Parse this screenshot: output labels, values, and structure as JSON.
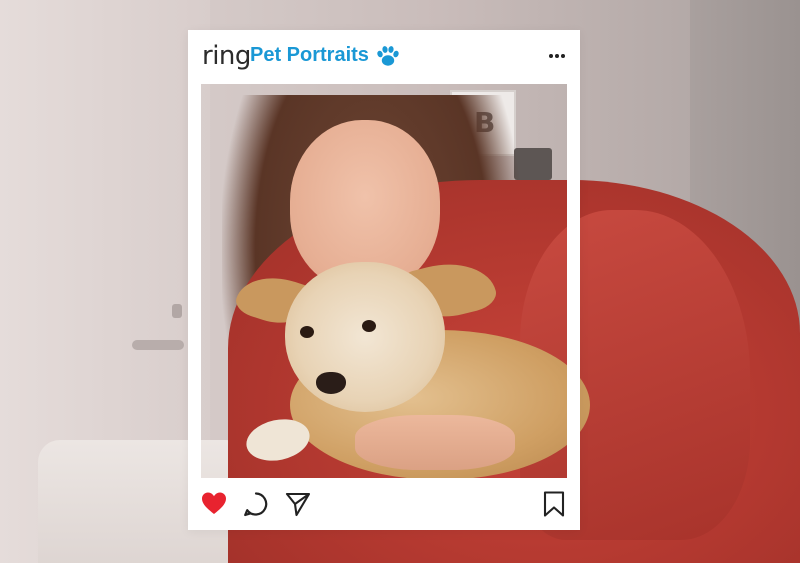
{
  "post": {
    "brand": "ring",
    "title": "Pet Portraits",
    "title_icon": "paw-icon",
    "menu_icon": "more-dots-icon",
    "actions": {
      "like": {
        "icon": "heart-icon",
        "state": "liked",
        "color": "#e8232f"
      },
      "comment": {
        "icon": "comment-icon"
      },
      "share": {
        "icon": "send-icon"
      },
      "save": {
        "icon": "bookmark-icon"
      }
    }
  },
  "colors": {
    "brand_blue": "#1a98d5",
    "frame_white": "#ffffff",
    "icon_dark": "#222222"
  }
}
